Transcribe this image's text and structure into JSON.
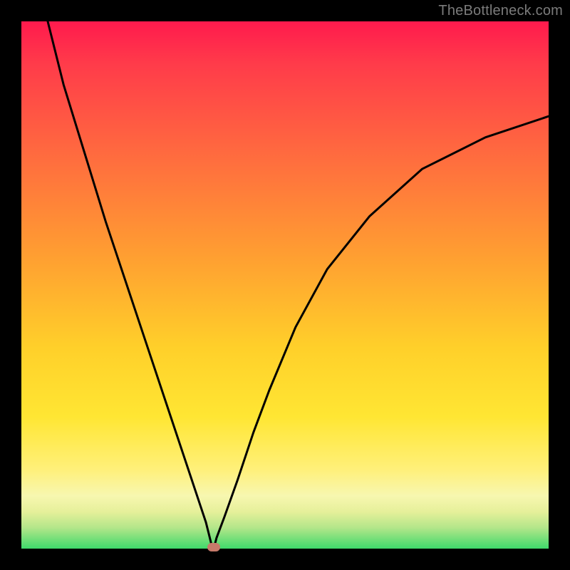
{
  "watermark": "TheBottleneck.com",
  "chart_data": {
    "type": "line",
    "title": "",
    "xlabel": "",
    "ylabel": "",
    "xlim": [
      0,
      100
    ],
    "ylim": [
      0,
      100
    ],
    "grid": false,
    "legend": false,
    "gradient_bands": [
      {
        "name": "red",
        "color": "#ff1a4d",
        "stop": 0
      },
      {
        "name": "orange",
        "color": "#ffa031",
        "stop": 45
      },
      {
        "name": "yellow",
        "color": "#ffe633",
        "stop": 75
      },
      {
        "name": "green",
        "color": "#3fd96b",
        "stop": 100
      }
    ],
    "series": [
      {
        "name": "bottleneck-curve",
        "color": "#000000",
        "x": [
          5,
          8,
          12,
          16,
          20,
          24,
          28,
          32,
          34,
          35,
          35.5,
          36,
          36.5,
          37,
          38.5,
          41,
          44,
          47,
          52,
          58,
          66,
          76,
          88,
          100
        ],
        "y": [
          100,
          88,
          75,
          62,
          50,
          38,
          26,
          14,
          8,
          5,
          3,
          1,
          0,
          2,
          6,
          13,
          22,
          30,
          42,
          53,
          63,
          72,
          78,
          82
        ]
      }
    ],
    "marker": {
      "x": 36.5,
      "y": 0,
      "color": "#c77a6a"
    }
  }
}
